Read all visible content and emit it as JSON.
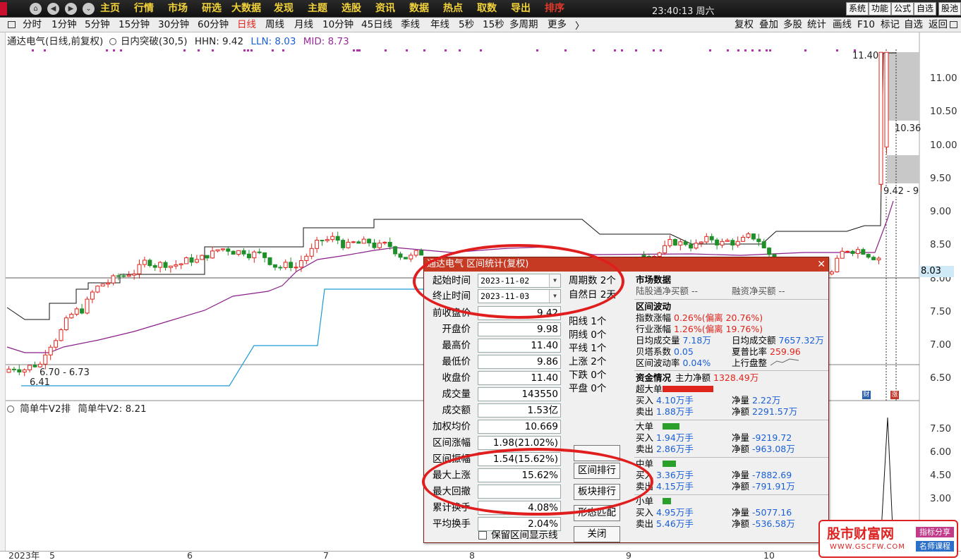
{
  "menu_bar": {
    "items": [
      "主页",
      "行情",
      "市场",
      "研选",
      "大数据",
      "发现",
      "主题",
      "选股",
      "资讯",
      "数据",
      "热点",
      "取数",
      "导出",
      "排序"
    ],
    "clock": "23:40:13 周六",
    "right_buttons": [
      "系统",
      "功能",
      "公式",
      "自选",
      "股池"
    ]
  },
  "period_bar": {
    "items": [
      "分时",
      "1分钟",
      "5分钟",
      "15分钟",
      "30分钟",
      "60分钟",
      "日线",
      "周线",
      "月线",
      "10分钟",
      "45日线",
      "季线",
      "年线",
      "5秒",
      "15秒",
      "多周期",
      "更多"
    ],
    "active": "日线",
    "right_items": [
      "复权",
      "叠加",
      "多股",
      "统计",
      "画线",
      "F10",
      "标记",
      "自选",
      "返回"
    ]
  },
  "chart_header": {
    "title": "通达电气(日线,前复权)",
    "indicator": "日内突破(30,5)",
    "hhn": "HHN: 9.42",
    "lln": "LLN: 8.03",
    "mid": "MID: 8.73"
  },
  "chart_data": {
    "type": "candlestick",
    "y_ticks": [
      "11.00",
      "10.50",
      "10.00",
      "9.50",
      "9.00",
      "8.50",
      "8.00",
      "7.50",
      "7.00",
      "6.50"
    ],
    "price_line": "8.03",
    "annotations": [
      "11.40",
      "10.36",
      "9.42 - 9",
      "6.70 - 6.73",
      "6.41"
    ],
    "x_labels": [
      "2023年",
      "5",
      "6",
      "7",
      "8",
      "9",
      "10"
    ],
    "sub_indicator": {
      "title": "简单牛V2排",
      "value": "简单牛V2: 8.21",
      "y_ticks": [
        "7.50",
        "6.00",
        "4.50",
        "3.00"
      ]
    }
  },
  "dialog": {
    "title": "通达电气 区间统计(复权)",
    "start_label": "起始时间",
    "start_value": "2023-11-02",
    "end_label": "终止时间",
    "end_value": "2023-11-03",
    "period_count": "周期数 2个",
    "natural_days": "自然日 2天",
    "fields": [
      {
        "label": "前收盘价",
        "value": "9.42"
      },
      {
        "label": "开盘价",
        "value": "9.98"
      },
      {
        "label": "最高价",
        "value": "11.40"
      },
      {
        "label": "最低价",
        "value": "9.86"
      },
      {
        "label": "收盘价",
        "value": "11.40"
      },
      {
        "label": "成交量",
        "value": "143550"
      },
      {
        "label": "成交额",
        "value": "1.53亿"
      },
      {
        "label": "加权均价",
        "value": "10.669"
      },
      {
        "label": "区间涨幅",
        "value": "1.98(21.02%)"
      },
      {
        "label": "区间振幅",
        "value": "1.54(15.62%)"
      },
      {
        "label": "最大上涨",
        "value": "15.62%"
      },
      {
        "label": "最大回撤",
        "value": ""
      },
      {
        "label": "累计换手",
        "value": "4.08%"
      },
      {
        "label": "平均换手",
        "value": "2.04%"
      }
    ],
    "mid_stats": [
      "阳线 1个",
      "阴线 0个",
      "平线 1个",
      "上涨 2个",
      "下跌 0个",
      "平盘 0个"
    ],
    "buttons": [
      "区间排行",
      "板块排行",
      "形态匹配",
      "关闭"
    ],
    "keep_line_label": "保留区间显示线",
    "market": {
      "title": "市场数据",
      "northbound": "陆股通净买额 --",
      "margin": "融资净买额 --"
    },
    "range_vol": {
      "title": "区间波动",
      "index_label": "指数涨幅",
      "index_val": "0.26%",
      "index_dev_label": "(偏离",
      "index_dev": "20.76%)",
      "industry_label": "行业涨幅",
      "industry_val": "1.26%",
      "industry_dev_label": "(偏离",
      "industry_dev": "19.76%)",
      "avg_vol_label": "日均成交量",
      "avg_vol": "7.18万",
      "avg_amt_label": "日均成交额",
      "avg_amt": "7657.32万",
      "beta_label": "贝塔系数",
      "beta": "0.05",
      "sharpe_label": "夏普比率",
      "sharpe": "259.96",
      "volatility_label": "区间波动率",
      "volatility": "0.04%",
      "trend": "上行盘整"
    },
    "funds": {
      "title": "资金情况",
      "main_label": "主力净额",
      "main_val": "1328.49万",
      "groups": [
        {
          "name": "超大单",
          "color": "#e0231b",
          "bar": 0.6,
          "buy": "4.10万手",
          "sell": "1.88万手",
          "net1_label": "净量",
          "net1": "2.22万",
          "net2_label": "净额",
          "net2": "2291.57万",
          "neg": false
        },
        {
          "name": "大单",
          "color": "#2aa02a",
          "bar": 0.2,
          "buy": "1.94万手",
          "sell": "2.86万手",
          "net1_label": "净量",
          "net1": "-9219.72",
          "net2_label": "净额",
          "net2": "-963.08万",
          "neg": true
        },
        {
          "name": "中单",
          "color": "#2aa02a",
          "bar": 0.16,
          "buy": "3.36万手",
          "sell": "4.15万手",
          "net1_label": "净量",
          "net1": "-7882.69",
          "net2_label": "净额",
          "net2": "-791.91万",
          "neg": true
        },
        {
          "name": "小单",
          "color": "#2aa02a",
          "bar": 0.1,
          "buy": "4.95万手",
          "sell": "5.46万手",
          "net1_label": "净量",
          "net1": "-5077.16",
          "net2_label": "净额",
          "net2": "-536.58万",
          "neg": true
        }
      ],
      "buy_label": "买入",
      "sell_label": "卖出"
    }
  },
  "watermark": {
    "title": "股市财富网",
    "url": "WWW.GSCFW.COM",
    "tag1": "指标分享",
    "tag2": "名师课程"
  },
  "colors": {
    "up": "#e0231b",
    "down": "#1f8f2a",
    "upper_band": "#111111",
    "mid_band": "#8a1f8a",
    "lower_band": "#1e9ad6",
    "highlight": "#e01e1e"
  }
}
